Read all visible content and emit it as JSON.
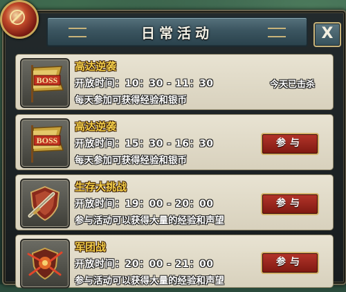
{
  "window": {
    "title": "日常活动",
    "close_label": "X"
  },
  "activities": [
    {
      "name": "高达逆袭",
      "time": "开放时间：10：30 - 11：30",
      "desc": "每天参加可获得经验和银币",
      "status": "今天已击杀",
      "icon": "boss-flag-icon",
      "icon_text": "BOSS"
    },
    {
      "name": "高达逆袭",
      "time": "开放时间：15：30 - 16：30",
      "desc": "每天参加可获得经验和银币",
      "button": "参与",
      "icon": "boss-flag-icon",
      "icon_text": "BOSS"
    },
    {
      "name": "生存大挑战",
      "time": "开放时间：19：00 - 20：00",
      "desc": "参与活动可以获得大量的经验和声望",
      "button": "参与",
      "icon": "sword-shield-icon"
    },
    {
      "name": "军团战",
      "time": "开放时间：20：00 - 21：00",
      "desc": "参与活动可以获得大量的经验和声望",
      "button": "参与",
      "icon": "battle-shield-icon"
    }
  ],
  "colors": {
    "name": "#f4cf4a",
    "button": "#9c241b",
    "row_bg": "#e0dac7"
  }
}
